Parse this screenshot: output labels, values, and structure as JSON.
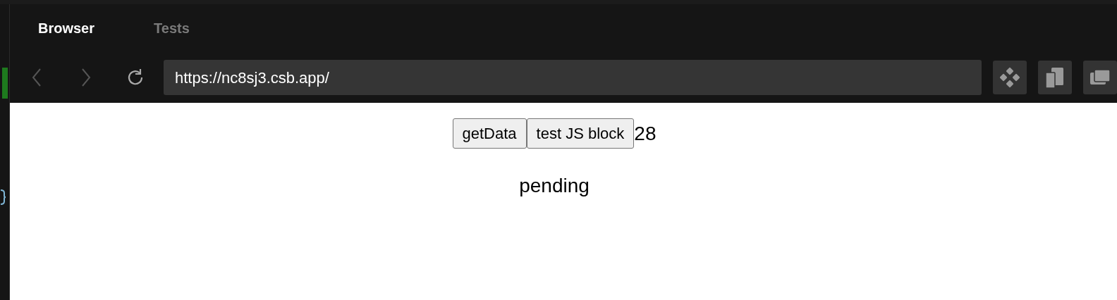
{
  "tabs": [
    {
      "label": "Browser",
      "selected": true
    },
    {
      "label": "Tests",
      "selected": false
    }
  ],
  "address_bar": {
    "value": "https://nc8sj3.csb.app/"
  },
  "page": {
    "buttons": [
      "getData",
      "test JS block"
    ],
    "count": "28",
    "status": "pending"
  }
}
